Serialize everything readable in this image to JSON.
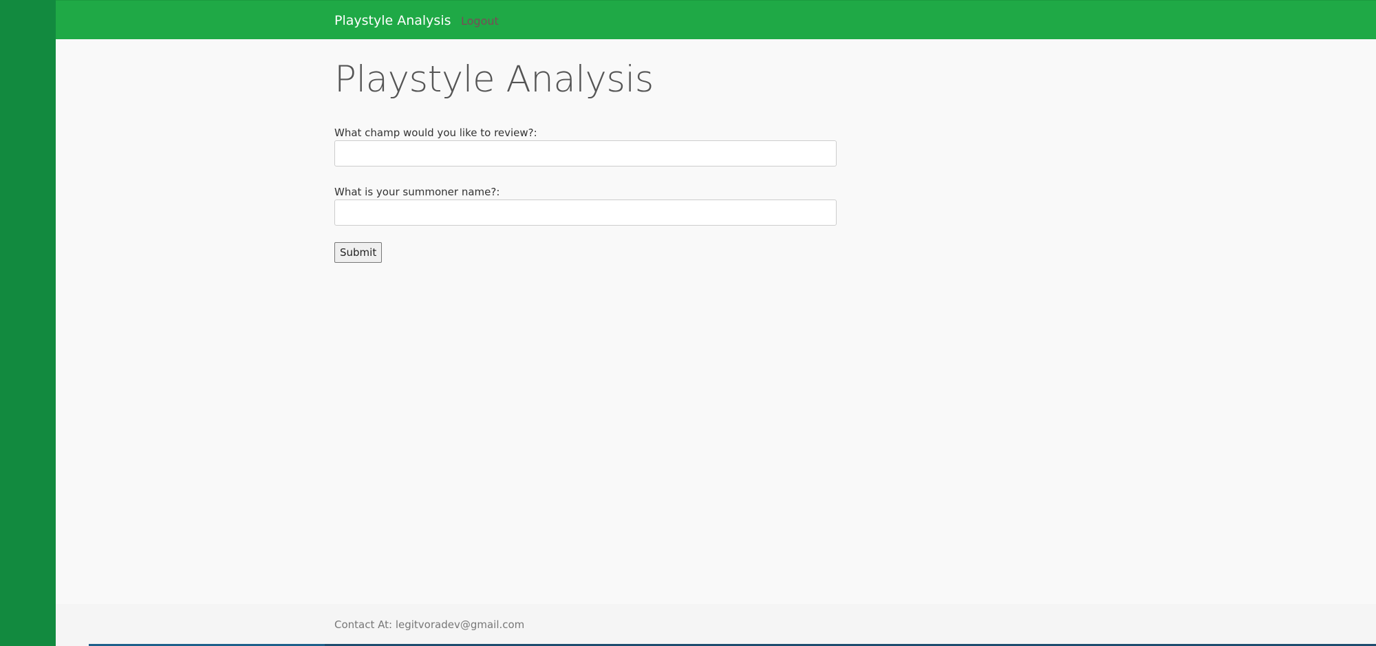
{
  "navbar": {
    "brand": "Playstyle Analysis",
    "logout_label": "Logout"
  },
  "main": {
    "title": "Playstyle Analysis",
    "form": {
      "champ_label": "What champ would you like to review?:",
      "champ_value": "",
      "summoner_label": "What is your summoner name?:",
      "summoner_value": "",
      "submit_label": "Submit"
    }
  },
  "footer": {
    "contact": "Contact At: legitvoradev@gmail.com"
  },
  "colors": {
    "navbar": "#1fa946",
    "sidebar": "#128a3f",
    "background": "#f9f9f9",
    "footer": "#f5f5f5"
  }
}
